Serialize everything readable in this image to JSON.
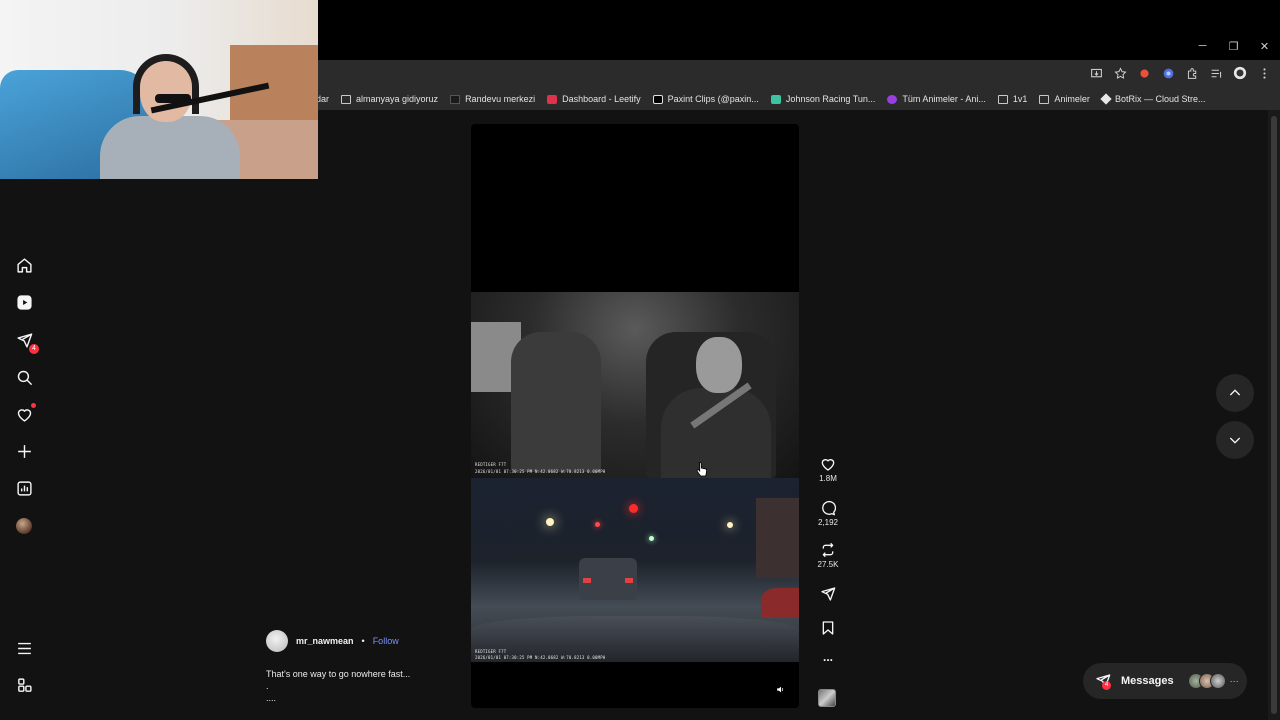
{
  "window": {
    "minimize_label": "─",
    "restore_label": "❐",
    "close_label": "✕"
  },
  "bookmarks": [
    {
      "label": "dar",
      "icon": "none"
    },
    {
      "label": "almanyaya gidiyoruz",
      "icon": "folder-icon"
    },
    {
      "label": "Randevu merkezi",
      "icon": "site-icon"
    },
    {
      "label": "Dashboard - Leetify",
      "icon": "leetify-icon"
    },
    {
      "label": "Paxint Clips (@paxin...",
      "icon": "tiktok-icon"
    },
    {
      "label": "Johnson Racing Tun...",
      "icon": "site-icon"
    },
    {
      "label": "Tüm Animeler - Ani...",
      "icon": "site-icon"
    },
    {
      "label": "1v1",
      "icon": "folder-icon"
    },
    {
      "label": "Animeler",
      "icon": "folder-icon"
    },
    {
      "label": "BotRix — Cloud Stre...",
      "icon": "botrix-icon"
    }
  ],
  "sidebar": {
    "items": [
      {
        "name": "home",
        "badge": ""
      },
      {
        "name": "reels",
        "badge": ""
      },
      {
        "name": "messages",
        "badge": "4"
      },
      {
        "name": "search",
        "badge": ""
      },
      {
        "name": "notifications",
        "badge": ""
      },
      {
        "name": "create",
        "badge": ""
      },
      {
        "name": "dashboard",
        "badge": ""
      },
      {
        "name": "profile",
        "badge": ""
      }
    ]
  },
  "video": {
    "cam_label_top": "REDTIGER F7T",
    "cam_stamp_top": "2026/01/01 07:30:25 PM  N:42.0682  W:70.8213  0.00MPH",
    "cam_label_bottom": "REDTIGER F7T",
    "cam_stamp_bottom": "2026/01/01 07:30:25 PM  N:42.0682  W:70.8213  0.00MPH",
    "mute_icon": "speaker-icon"
  },
  "actions": {
    "likes": "1.8M",
    "comments": "2,192",
    "reposts": "27.5K",
    "more_label": "..."
  },
  "author": {
    "username": "mr_nawmean",
    "separator": "•",
    "follow_label": "Follow",
    "caption_line1": "That's one way to go nowhere fast...",
    "caption_line2": ".",
    "caption_line3": "...."
  },
  "messages": {
    "label": "Messages",
    "badge": "4",
    "more": "···"
  },
  "colors": {
    "background": "#121212",
    "accent_link": "#7d8fff",
    "badge_red": "#ff3040",
    "chrome_bar": "#2b2b2b"
  }
}
